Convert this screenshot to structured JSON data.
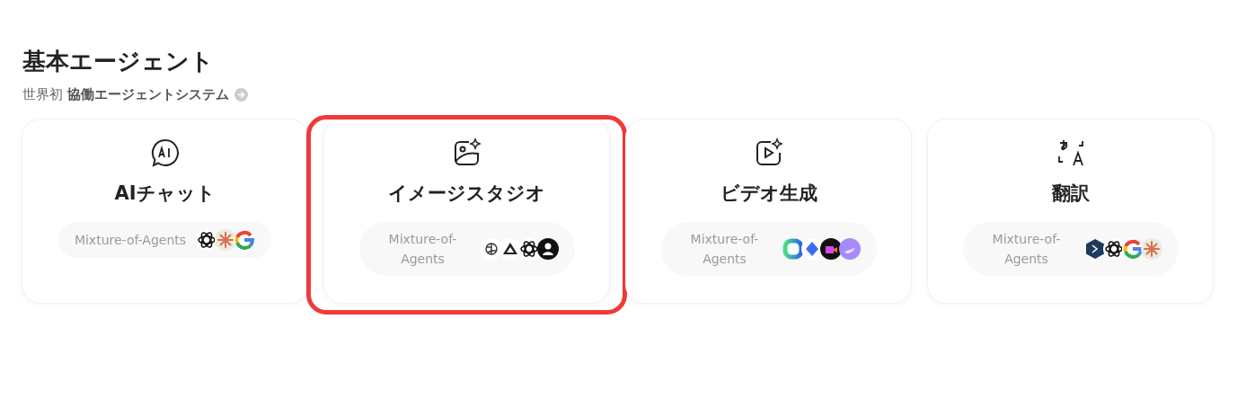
{
  "section": {
    "title": "基本エージェント",
    "subtitle": "世界初 **協働エージェントシステム**"
  },
  "cards": [
    {
      "title": "AIチャット",
      "pill": "Mixture-of-Agents",
      "highlighted": false
    },
    {
      "title": "イメージスタジオ",
      "pill": "Mixture-of-Agents",
      "highlighted": true
    },
    {
      "title": "ビデオ生成",
      "pill": "Mixture-of-Agents",
      "highlighted": false
    },
    {
      "title": "翻訳",
      "pill": "Mixture-of-Agents",
      "highlighted": false
    }
  ]
}
